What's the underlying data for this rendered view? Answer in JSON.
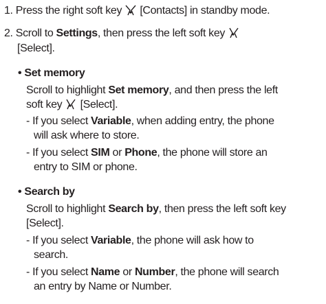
{
  "steps": [
    {
      "number": "1.",
      "text_before": "Press the right soft key",
      "icon": "right-soft-key-icon",
      "text_after": "[Contacts] in standby mode."
    },
    {
      "number": "2.",
      "text_a": "Scroll to",
      "bold_a": "Settings",
      "text_b": ", then press the left soft key",
      "icon": "left-soft-key-icon",
      "line2": "[Select]."
    }
  ],
  "sections": [
    {
      "heading": "Set memory",
      "desc_1a": "Scroll to highlight",
      "desc_1b": "Set memory",
      "desc_1c": ", and then press the left",
      "desc_2a": "soft key",
      "desc_2b": "[Select].",
      "items": [
        {
          "dash": "-",
          "a": "If you select",
          "b": "Variable",
          "c": ", when adding entry, the phone",
          "line2": "will ask where to store."
        },
        {
          "dash": "-",
          "a": "If you select",
          "b": "SIM",
          "c": "or",
          "d": "Phone",
          "e": ", the phone will store an",
          "line2": "entry to SIM or phone."
        }
      ]
    },
    {
      "heading": "Search by",
      "desc_1a": "Scroll to highlight",
      "desc_1b": "Search by",
      "desc_1c": ", then press the left soft key",
      "desc_2": "[Select].",
      "items": [
        {
          "dash": "-",
          "a": "If you select",
          "b": "Variable",
          "c": ", the phone will ask how to",
          "line2": "search."
        },
        {
          "dash": "-",
          "a": "If you select",
          "b": "Name",
          "c": "or",
          "d": "Number",
          "e": ", the phone will search",
          "line2": "an entry by Name or Number."
        }
      ]
    }
  ],
  "bullet_char": "•",
  "colors": {
    "text": "#231f20",
    "background": "#ffffff"
  }
}
